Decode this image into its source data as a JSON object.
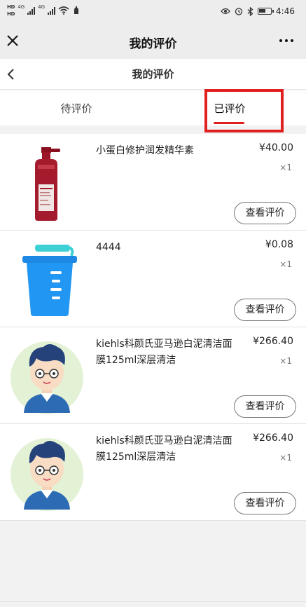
{
  "status_bar": {
    "hd1": "HD",
    "hd2": "HD",
    "net1": "4G",
    "net2": "4G",
    "time": "4:46",
    "battery_fraction": 0.6
  },
  "wechat_bar": {
    "title": "我的评价"
  },
  "page_header": {
    "title": "我的评价"
  },
  "tabs": [
    {
      "label": "待评价",
      "active": false
    },
    {
      "label": "已评价",
      "active": true
    }
  ],
  "accent_color": "#e02020",
  "items": [
    {
      "name": "小蛋白修护润发精华素",
      "price": "¥40.00",
      "qty": "×1",
      "button": "查看评价",
      "image": "red-bottle"
    },
    {
      "name": "4444",
      "price": "¥0.08",
      "qty": "×1",
      "button": "查看评价",
      "image": "blue-cup"
    },
    {
      "name": "kiehls科颜氏亚马逊白泥清洁面膜125ml深层清洁",
      "price": "¥266.40",
      "qty": "×1",
      "button": "查看评价",
      "image": "avatar"
    },
    {
      "name": "kiehls科颜氏亚马逊白泥清洁面膜125ml深层清洁",
      "price": "¥266.40",
      "qty": "×1",
      "button": "查看评价",
      "image": "avatar"
    }
  ]
}
